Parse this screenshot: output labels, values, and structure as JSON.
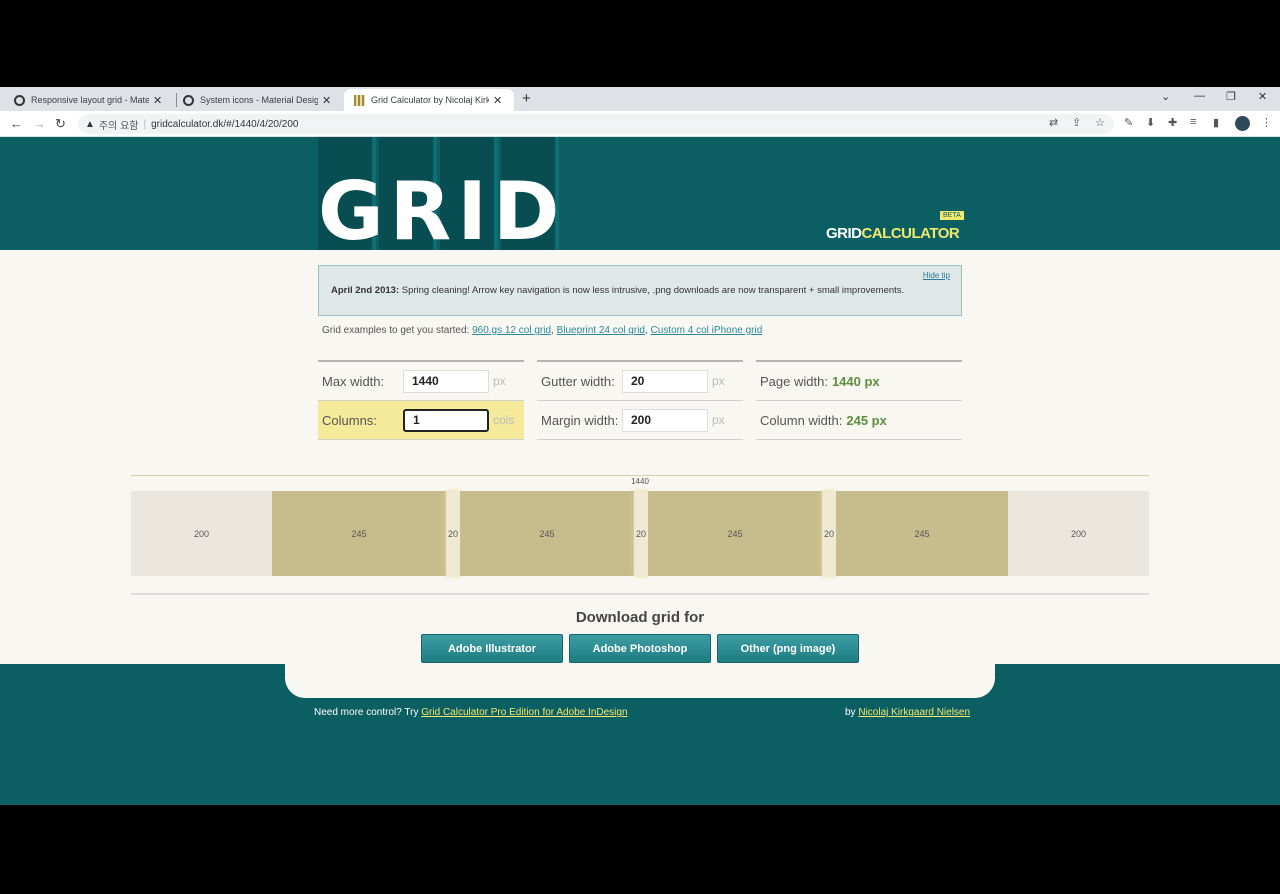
{
  "browser": {
    "tabs": [
      {
        "title": "Responsive layout grid - Material D",
        "active": false
      },
      {
        "title": "System icons - Material Design",
        "active": false
      },
      {
        "title": "Grid Calculator by Nicolaj Kirkgaard",
        "active": true
      }
    ],
    "new_tab": "+",
    "address": {
      "warning": "▲",
      "security_text": "주의 요함",
      "url": "gridcalculator.dk/#/1440/4/20/200"
    }
  },
  "header": {
    "logo_text": "GRID",
    "brand_left": "GRID",
    "brand_right": "CALCULATOR",
    "beta": "BETA"
  },
  "tip": {
    "hide_label": "Hide tip",
    "date": "April 2nd 2013:",
    "message": "Spring cleaning! Arrow key navigation is now less intrusive, .png downloads are now transparent + small improvements."
  },
  "examples": {
    "intro": "Grid examples to get you started:",
    "links": [
      "960.gs 12 col grid",
      "Blueprint 24 col grid",
      "Custom 4 col iPhone grid"
    ]
  },
  "form": {
    "max_width_label": "Max width:",
    "max_width_value": "1440",
    "max_width_unit": "px",
    "columns_label": "Columns:",
    "columns_value": "1",
    "columns_unit": "cols",
    "gutter_label": "Gutter width:",
    "gutter_value": "20",
    "gutter_unit": "px",
    "margin_label": "Margin width:",
    "margin_value": "200",
    "margin_unit": "px",
    "page_width_label": "Page width:",
    "page_width_value": "1440 px",
    "column_width_label": "Column width:",
    "column_width_value": "245 px"
  },
  "grid_preview": {
    "total_label": "1440",
    "segments": [
      "200",
      "245",
      "20",
      "245",
      "20",
      "245",
      "20",
      "245",
      "200"
    ]
  },
  "download": {
    "title": "Download grid for",
    "buttons": [
      "Adobe Illustrator",
      "Adobe Photoshop",
      "Other (png image)"
    ]
  },
  "footer": {
    "left_text": "Need more control? Try",
    "left_link": "Grid Calculator Pro Edition for Adobe InDesign",
    "right_text": "by",
    "right_link": "Nicolaj Kirkgaard Nielsen"
  },
  "colors": {
    "brand_teal": "#0b5f63",
    "accent_yellow": "#f2e86d",
    "value_green": "#5e8e3c",
    "column_khaki": "#c7bc8c"
  }
}
